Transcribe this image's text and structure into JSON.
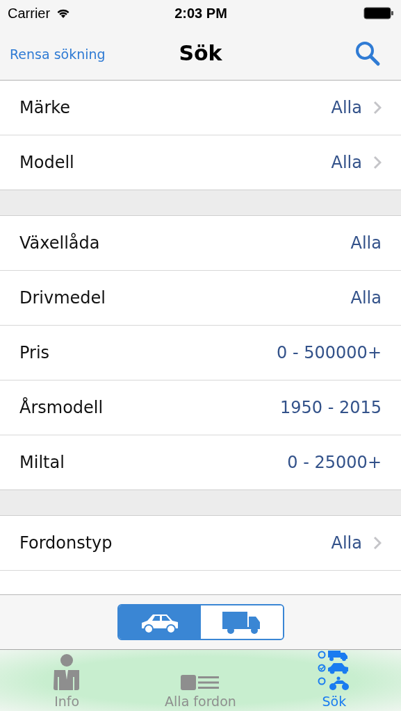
{
  "status_bar": {
    "carrier": "Carrier",
    "time": "2:03 PM"
  },
  "nav": {
    "left_button": "Rensa sökning",
    "title": "Sök"
  },
  "sections": [
    {
      "rows": [
        {
          "label": "Märke",
          "value": "Alla",
          "chevron": true
        },
        {
          "label": "Modell",
          "value": "Alla",
          "chevron": true
        }
      ]
    },
    {
      "rows": [
        {
          "label": "Växellåda",
          "value": "Alla",
          "chevron": false
        },
        {
          "label": "Drivmedel",
          "value": "Alla",
          "chevron": false
        },
        {
          "label": "Pris",
          "value": "0 - 500000+",
          "chevron": false
        },
        {
          "label": "Årsmodell",
          "value": "1950 - 2015",
          "chevron": false
        },
        {
          "label": "Miltal",
          "value": "0 - 25000+",
          "chevron": false
        }
      ]
    },
    {
      "rows": [
        {
          "label": "Fordonstyp",
          "value": "Alla",
          "chevron": true
        }
      ]
    }
  ],
  "vehicle_segments": [
    {
      "kind": "car",
      "selected": true
    },
    {
      "kind": "truck",
      "selected": false
    }
  ],
  "tabs": [
    {
      "kind": "person",
      "label": "Info",
      "selected": false
    },
    {
      "kind": "list",
      "label": "Alla fordon",
      "selected": false
    },
    {
      "kind": "search",
      "label": "Sök",
      "selected": true
    }
  ]
}
